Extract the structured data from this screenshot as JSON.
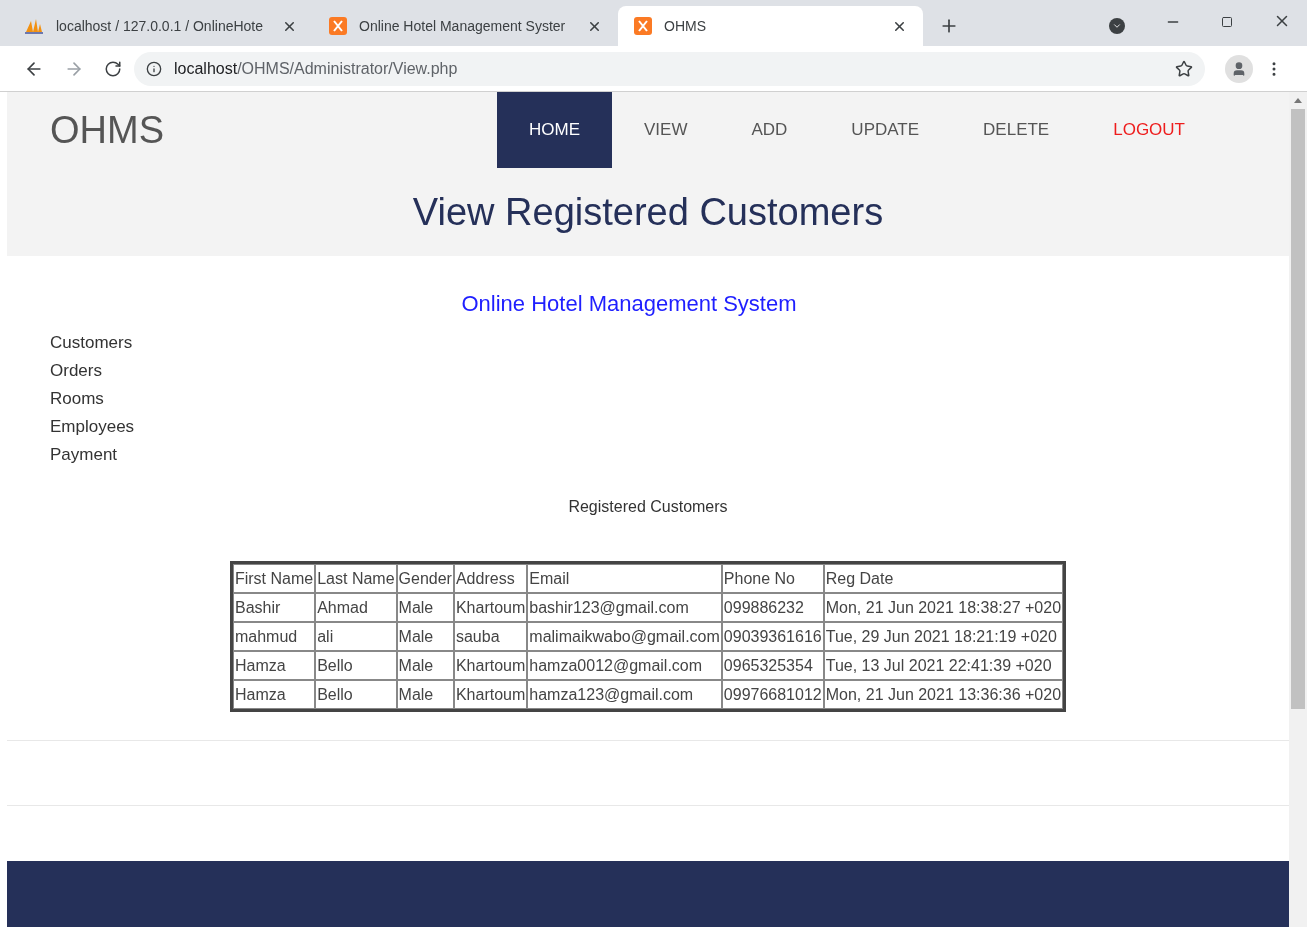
{
  "browser": {
    "tabs": [
      {
        "title": "localhost / 127.0.0.1 / OnlineHote",
        "kind": "pma",
        "selected": false
      },
      {
        "title": "Online Hotel Management Syster",
        "kind": "xampp",
        "selected": false
      },
      {
        "title": "OHMS",
        "kind": "xampp",
        "selected": true
      }
    ],
    "address": {
      "host": "localhost",
      "path": "/OHMS/Administrator/View.php"
    }
  },
  "site": {
    "logo": "OHMS",
    "nav": [
      {
        "label": "HOME",
        "selected": true,
        "kind": "link"
      },
      {
        "label": "VIEW",
        "selected": false,
        "kind": "link"
      },
      {
        "label": "ADD",
        "selected": false,
        "kind": "link"
      },
      {
        "label": "UPDATE",
        "selected": false,
        "kind": "link"
      },
      {
        "label": "DELETE",
        "selected": false,
        "kind": "link"
      },
      {
        "label": "LOGOUT",
        "selected": false,
        "kind": "logout"
      }
    ],
    "page_title": "View Registered Customers"
  },
  "subtitle": "Online Hotel Management System",
  "sidebar": {
    "items": [
      "Customers",
      "Orders",
      "Rooms",
      "Employees",
      "Payment"
    ]
  },
  "table": {
    "caption": "Registered Customers",
    "columns": [
      "First Name",
      "Last Name",
      "Gender",
      "Address",
      "Email",
      "Phone No",
      "Reg Date"
    ],
    "rows": [
      [
        "Bashir",
        "Ahmad",
        "Male",
        "Khartoum",
        "bashir123@gmail.com",
        "099886232",
        "Mon, 21 Jun 2021 18:38:27 +020"
      ],
      [
        "mahmud",
        "ali",
        "Male",
        "sauba",
        "malimaikwabo@gmail.com",
        "09039361616",
        "Tue, 29 Jun 2021 18:21:19 +020"
      ],
      [
        "Hamza",
        "Bello",
        "Male",
        "Khartoum",
        "hamza0012@gmail.com",
        "0965325354",
        "Tue, 13 Jul 2021 22:41:39 +020"
      ],
      [
        "Hamza",
        "Bello",
        "Male",
        "Khartoum",
        "hamza123@gmail.com",
        "09976681012",
        "Mon, 21 Jun 2021 13:36:36 +020"
      ]
    ]
  }
}
